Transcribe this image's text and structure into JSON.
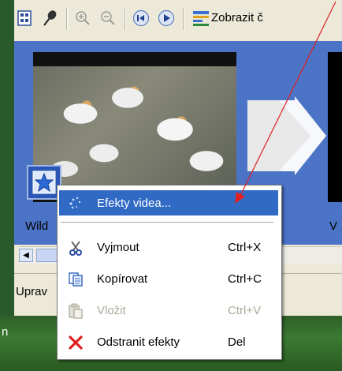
{
  "toolbar": {
    "view_label": "Zobrazit č",
    "icons": [
      "storyboard-icon",
      "pin-icon",
      "zoom-in-icon",
      "zoom-out-icon",
      "rewind-icon",
      "play-icon",
      "timeline-icon"
    ]
  },
  "storyboard": {
    "clip1_label": "Wild",
    "clip2_label": "V"
  },
  "status": {
    "text": "Uprav"
  },
  "desktop": {
    "text": "n"
  },
  "context_menu": {
    "items": [
      {
        "label": "Efekty videa...",
        "shortcut": "",
        "state": "highlighted",
        "icon": "video-effects-icon"
      },
      {
        "label": "Vyjmout",
        "shortcut": "Ctrl+X",
        "state": "enabled",
        "icon": "scissors-icon"
      },
      {
        "label": "Kopírovat",
        "shortcut": "Ctrl+C",
        "state": "enabled",
        "icon": "copy-icon"
      },
      {
        "label": "Vložit",
        "shortcut": "Ctrl+V",
        "state": "disabled",
        "icon": "paste-icon"
      },
      {
        "label": "Odstranit efekty",
        "shortcut": "Del",
        "state": "enabled",
        "icon": "delete-icon"
      }
    ]
  },
  "colors": {
    "highlight": "#316ac5",
    "storyboard_bg": "#4b73c6",
    "annotation": "#e02020"
  }
}
